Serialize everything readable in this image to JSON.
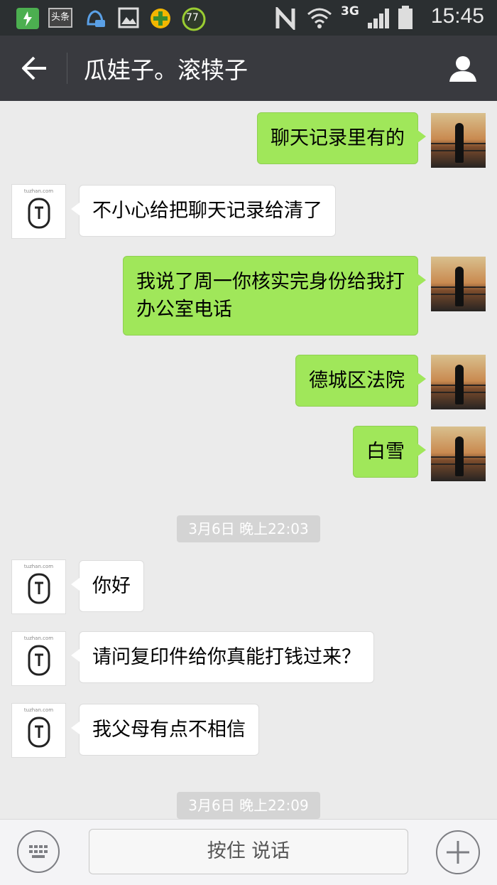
{
  "status_bar": {
    "time": "15:45",
    "network": "3G",
    "toutiao": "头条",
    "notification_badge": "77",
    "icons": [
      "battery-charging-icon",
      "toutiao-app-icon",
      "qq-notification-icon",
      "gallery-icon",
      "game-icon",
      "security-badge-icon",
      "nfc-icon",
      "wifi-icon",
      "signal-icon",
      "battery-icon"
    ]
  },
  "header": {
    "back_icon": "arrow-left-icon",
    "title": "瓜娃子。滚犊子",
    "profile_icon": "person-icon"
  },
  "messages": [
    {
      "sender": "me",
      "text": "聊天记录里有的"
    },
    {
      "sender": "other",
      "text": "不小心给把聊天记录给清了"
    },
    {
      "sender": "me",
      "text_line1": "我说了周一你核实完身份给我打",
      "text_line2": "办公室电话"
    },
    {
      "sender": "me",
      "text": "德城区法院"
    },
    {
      "sender": "me",
      "text": "白雪"
    },
    {
      "timestamp": "3月6日 晚上22:03"
    },
    {
      "sender": "other",
      "text": "你好"
    },
    {
      "sender": "other",
      "text": "请问复印件给你真能打钱过来？"
    },
    {
      "sender": "other",
      "text": "我父母有点不相信"
    },
    {
      "timestamp": "3月6日 晚上22:09"
    }
  ],
  "other_avatar_label": "tuzhan.com",
  "input_bar": {
    "keyboard_icon": "keyboard-icon",
    "hold_to_talk": "按住 说话",
    "plus_icon": "plus-circle-icon"
  },
  "colors": {
    "my_bubble": "#a0e75a",
    "other_bubble": "#ffffff",
    "chat_background": "#ebebeb",
    "nav_bar": "#393a3f",
    "status_bar": "#2b2f31"
  }
}
